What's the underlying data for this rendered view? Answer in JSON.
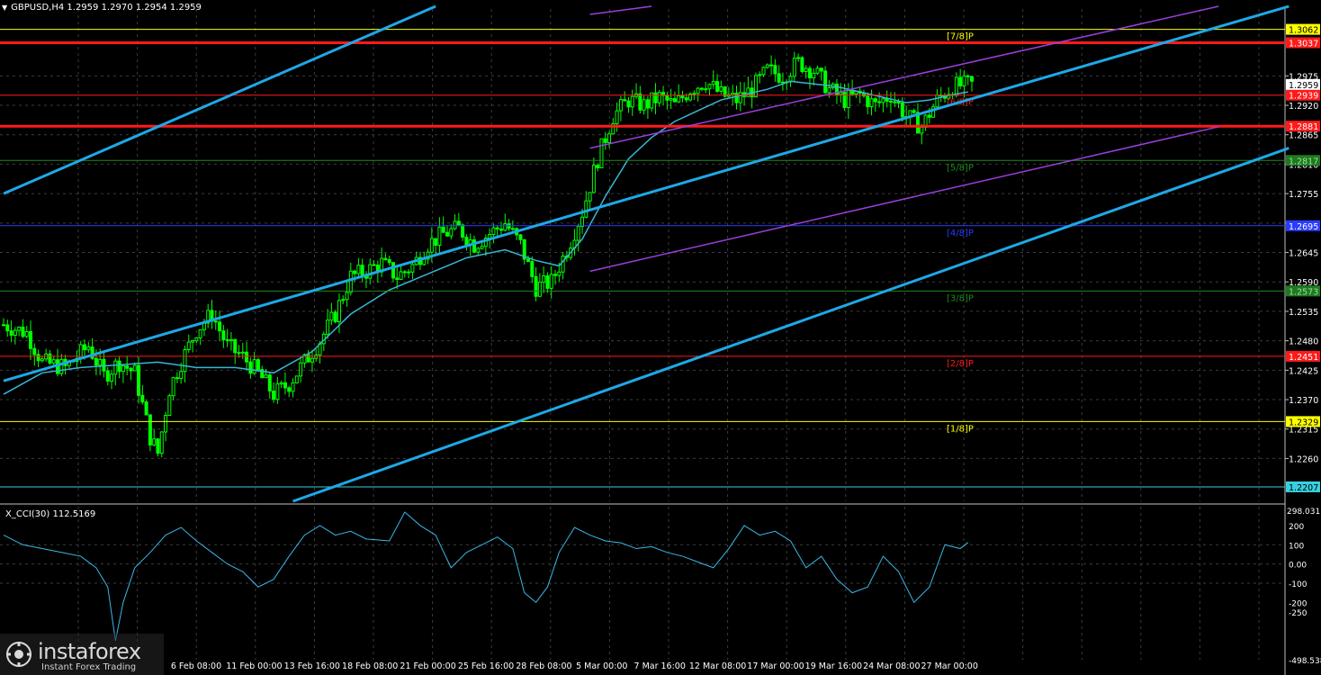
{
  "header": {
    "symbol_line": "GBPUSD,H4  1.2959 1.2970 1.2954 1.2959",
    "cci_line": "X_CCI(30) 112.5169",
    "cci_top_value": "298.0311"
  },
  "logo": {
    "name": "instaforex",
    "tagline": "Instant Forex Trading"
  },
  "colors": {
    "background": "#000000",
    "grid": "#3c3c3c",
    "candle": "#00ff00",
    "ma": "#38b6d6",
    "channel": "#1fa8e6",
    "pitchfork": "#9a3fdb",
    "cci": "#3ab8e8"
  },
  "chart_data": {
    "type": "candlestick",
    "symbol": "GBPUSD",
    "timeframe": "H4",
    "ohlc_last": {
      "open": 1.2959,
      "high": 1.297,
      "low": 1.2954,
      "close": 1.2959
    },
    "ylim": [
      1.218,
      1.31
    ],
    "y_ticks": [
      "1.2975",
      "1.2920",
      "1.2865",
      "1.2810",
      "1.2755",
      "1.2700",
      "1.2645",
      "1.2590",
      "1.2535",
      "1.2480",
      "1.2425",
      "1.2370",
      "1.2315",
      "1.2260"
    ],
    "x_ticks": [
      "6 Feb 08:00",
      "11 Feb 00:00",
      "13 Feb 16:00",
      "18 Feb 08:00",
      "21 Feb 00:00",
      "25 Feb 16:00",
      "28 Feb 08:00",
      "5 Mar 00:00",
      "7 Mar 16:00",
      "12 Mar 08:00",
      "17 Mar 00:00",
      "19 Mar 16:00",
      "24 Mar 08:00",
      "27 Mar 00:00"
    ],
    "price_path": [
      [
        0,
        1.251
      ],
      [
        6,
        1.2495
      ],
      [
        10,
        1.244
      ],
      [
        16,
        1.243
      ],
      [
        22,
        1.247
      ],
      [
        26,
        1.2415
      ],
      [
        30,
        1.244
      ],
      [
        34,
        1.242
      ],
      [
        38,
        1.23
      ],
      [
        40,
        1.227
      ],
      [
        43,
        1.239
      ],
      [
        46,
        1.244
      ],
      [
        50,
        1.25
      ],
      [
        54,
        1.253
      ],
      [
        58,
        1.247
      ],
      [
        62,
        1.245
      ],
      [
        66,
        1.242
      ],
      [
        70,
        1.238
      ],
      [
        74,
        1.24
      ],
      [
        78,
        1.244
      ],
      [
        82,
        1.248
      ],
      [
        86,
        1.253
      ],
      [
        90,
        1.26
      ],
      [
        94,
        1.261
      ],
      [
        98,
        1.2625
      ],
      [
        102,
        1.26
      ],
      [
        106,
        1.262
      ],
      [
        110,
        1.266
      ],
      [
        114,
        1.268
      ],
      [
        118,
        1.269
      ],
      [
        122,
        1.266
      ],
      [
        126,
        1.268
      ],
      [
        130,
        1.27
      ],
      [
        134,
        1.266
      ],
      [
        138,
        1.258
      ],
      [
        142,
        1.259
      ],
      [
        146,
        1.265
      ],
      [
        150,
        1.272
      ],
      [
        154,
        1.282
      ],
      [
        158,
        1.29
      ],
      [
        162,
        1.293
      ],
      [
        166,
        1.292
      ],
      [
        170,
        1.2935
      ],
      [
        174,
        1.292
      ],
      [
        178,
        1.295
      ],
      [
        182,
        1.2965
      ],
      [
        186,
        1.294
      ],
      [
        190,
        1.293
      ],
      [
        194,
        1.295
      ],
      [
        198,
        1.2985
      ],
      [
        202,
        1.2975
      ],
      [
        206,
        1.3
      ],
      [
        210,
        1.2985
      ],
      [
        214,
        1.295
      ],
      [
        218,
        1.293
      ],
      [
        222,
        1.294
      ],
      [
        226,
        1.292
      ],
      [
        230,
        1.294
      ],
      [
        234,
        1.29
      ],
      [
        238,
        1.288
      ],
      [
        242,
        1.293
      ],
      [
        246,
        1.2955
      ],
      [
        250,
        1.2959
      ]
    ],
    "ma_path": [
      [
        0,
        1.238
      ],
      [
        10,
        1.242
      ],
      [
        20,
        1.243
      ],
      [
        30,
        1.2435
      ],
      [
        40,
        1.244
      ],
      [
        50,
        1.243
      ],
      [
        60,
        1.243
      ],
      [
        70,
        1.242
      ],
      [
        80,
        1.246
      ],
      [
        90,
        1.253
      ],
      [
        100,
        1.2575
      ],
      [
        110,
        1.2605
      ],
      [
        120,
        1.2635
      ],
      [
        130,
        1.265
      ],
      [
        138,
        1.263
      ],
      [
        144,
        1.262
      ],
      [
        150,
        1.267
      ],
      [
        156,
        1.275
      ],
      [
        162,
        1.282
      ],
      [
        168,
        1.286
      ],
      [
        174,
        1.289
      ],
      [
        180,
        1.291
      ],
      [
        186,
        1.293
      ],
      [
        192,
        1.294
      ],
      [
        198,
        1.295
      ],
      [
        204,
        1.2965
      ],
      [
        210,
        1.296
      ],
      [
        216,
        1.2955
      ],
      [
        222,
        1.2945
      ],
      [
        228,
        1.2935
      ],
      [
        234,
        1.2925
      ],
      [
        240,
        1.293
      ],
      [
        246,
        1.294
      ],
      [
        250,
        1.2945
      ]
    ],
    "bars": 252,
    "levels": [
      {
        "price": 1.3062,
        "label": "1.3062",
        "color": "#ffff00",
        "bg": "#ffff00",
        "fg": "#000000",
        "murrey": "[7/8]P",
        "thick": 1
      },
      {
        "price": 1.3037,
        "label": "1.3037",
        "color": "#ff1a1a",
        "bg": "#ff1a1a",
        "fg": "#ffffff",
        "murrey": "",
        "thick": 3
      },
      {
        "price": 1.2939,
        "label": "1.2939",
        "color": "#ff1a1a",
        "bg": "#ff1a1a",
        "fg": "#ffffff",
        "murrey": "[6/8]P",
        "thick": 1
      },
      {
        "price": 1.2881,
        "label": "1.2881",
        "color": "#ff1a1a",
        "bg": "#ff1a1a",
        "fg": "#ffffff",
        "murrey": "",
        "thick": 3
      },
      {
        "price": 1.2817,
        "label": "1.2817",
        "color": "#1a8c1a",
        "bg": "#1f7a1f",
        "fg": "#9be09b",
        "murrey": "[5/8]P",
        "thick": 1
      },
      {
        "price": 1.2695,
        "label": "1.2695",
        "color": "#2a3cff",
        "bg": "#2a3cff",
        "fg": "#ffffff",
        "murrey": "[4/8]P",
        "thick": 1
      },
      {
        "price": 1.2573,
        "label": "1.2573",
        "color": "#1a8c1a",
        "bg": "#1f7a1f",
        "fg": "#9be09b",
        "murrey": "[3/8]P",
        "thick": 1
      },
      {
        "price": 1.2451,
        "label": "1.2451",
        "color": "#ff1a1a",
        "bg": "#ff1a1a",
        "fg": "#ffffff",
        "murrey": "[2/8]P",
        "thick": 1
      },
      {
        "price": 1.2329,
        "label": "1.2329",
        "color": "#ffff00",
        "bg": "#ffff00",
        "fg": "#000000",
        "murrey": "[1/8]P",
        "thick": 1
      },
      {
        "price": 1.2207,
        "label": "1.2207",
        "color": "#38d0e0",
        "bg": "#38d0e0",
        "fg": "#000000",
        "murrey": "",
        "thick": 1
      }
    ],
    "last_price": {
      "price": 1.2959,
      "label": "1.2959"
    },
    "channels": [
      {
        "from": [
          0,
          1.2755
        ],
        "to": [
          112,
          1.3105
        ]
      },
      {
        "from": [
          0,
          1.2405
        ],
        "to": [
          252,
          1.3105
        ]
      },
      {
        "from": [
          75,
          1.218
        ],
        "to": [
          252,
          1.284
        ]
      }
    ],
    "pitchfork": [
      {
        "from": [
          152,
          1.309
        ],
        "to": [
          168,
          1.3105
        ]
      },
      {
        "from": [
          152,
          1.284
        ],
        "to": [
          252,
          1.3105
        ]
      },
      {
        "from": [
          152,
          1.261
        ],
        "to": [
          252,
          1.288
        ]
      }
    ],
    "cci": {
      "name": "X_CCI(30)",
      "value": 112.5169,
      "ylim": [
        -498.538,
        298.0311
      ],
      "y_ticks": [
        "298.0311",
        "200",
        "100",
        "0.00",
        "-100",
        "-200",
        "-250",
        "-498.538"
      ],
      "path": [
        [
          0,
          150
        ],
        [
          5,
          100
        ],
        [
          10,
          80
        ],
        [
          15,
          60
        ],
        [
          20,
          40
        ],
        [
          24,
          -20
        ],
        [
          27,
          -120
        ],
        [
          29,
          -400
        ],
        [
          31,
          -200
        ],
        [
          34,
          -20
        ],
        [
          38,
          60
        ],
        [
          42,
          150
        ],
        [
          46,
          190
        ],
        [
          50,
          120
        ],
        [
          54,
          60
        ],
        [
          58,
          0
        ],
        [
          62,
          -40
        ],
        [
          66,
          -120
        ],
        [
          70,
          -80
        ],
        [
          74,
          40
        ],
        [
          78,
          150
        ],
        [
          82,
          200
        ],
        [
          86,
          150
        ],
        [
          90,
          170
        ],
        [
          94,
          130
        ],
        [
          100,
          120
        ],
        [
          104,
          270
        ],
        [
          108,
          200
        ],
        [
          112,
          150
        ],
        [
          116,
          -20
        ],
        [
          120,
          60
        ],
        [
          124,
          100
        ],
        [
          128,
          140
        ],
        [
          132,
          80
        ],
        [
          135,
          -150
        ],
        [
          138,
          -200
        ],
        [
          141,
          -120
        ],
        [
          144,
          60
        ],
        [
          148,
          190
        ],
        [
          152,
          150
        ],
        [
          156,
          120
        ],
        [
          160,
          110
        ],
        [
          164,
          80
        ],
        [
          168,
          90
        ],
        [
          172,
          60
        ],
        [
          176,
          40
        ],
        [
          180,
          10
        ],
        [
          184,
          -20
        ],
        [
          188,
          80
        ],
        [
          192,
          200
        ],
        [
          196,
          150
        ],
        [
          200,
          170
        ],
        [
          204,
          120
        ],
        [
          208,
          -20
        ],
        [
          212,
          40
        ],
        [
          216,
          -80
        ],
        [
          220,
          -150
        ],
        [
          224,
          -120
        ],
        [
          228,
          40
        ],
        [
          232,
          -40
        ],
        [
          236,
          -200
        ],
        [
          240,
          -120
        ],
        [
          244,
          100
        ],
        [
          248,
          80
        ],
        [
          250,
          112
        ]
      ]
    }
  }
}
